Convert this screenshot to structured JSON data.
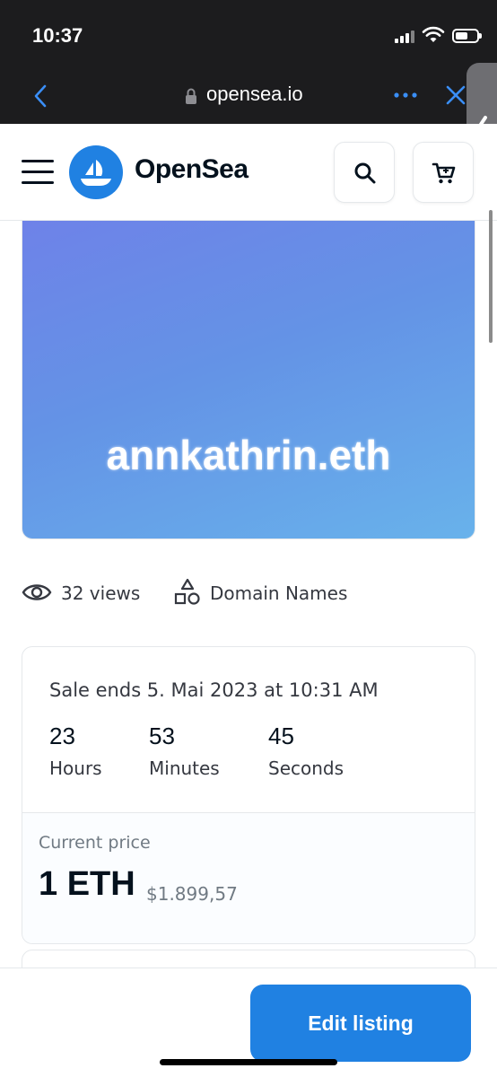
{
  "status_bar": {
    "time": "10:37",
    "battery_level": 0.6
  },
  "browser": {
    "url": "opensea.io",
    "icons": [
      "back-arrow-icon",
      "lock-icon",
      "more-dots-icon",
      "close-icon",
      "side-panel-chevron-icon"
    ]
  },
  "header": {
    "brand": "OpenSea",
    "icons": [
      "hamburger-menu-icon",
      "opensea-logo-icon",
      "search-icon",
      "cart-icon"
    ]
  },
  "nft": {
    "title": "annkathrin.eth"
  },
  "meta": {
    "views": "32 views",
    "category": "Domain Names"
  },
  "listing": {
    "sale_ends": "Sale ends 5. Mai 2023 at 10:31 AM",
    "countdown": [
      {
        "value": "23",
        "label": "Hours"
      },
      {
        "value": "53",
        "label": "Minutes"
      },
      {
        "value": "45",
        "label": "Seconds"
      }
    ],
    "price_label": "Current price",
    "price_eth": "1 ETH",
    "price_fiat": "$1.899,57"
  },
  "actions": {
    "edit_listing": "Edit listing"
  },
  "colors": {
    "brand_blue": "#2081e2",
    "text_dark": "#04111d",
    "text_muted": "#707a83",
    "chrome_dark": "#1c1c1e"
  }
}
